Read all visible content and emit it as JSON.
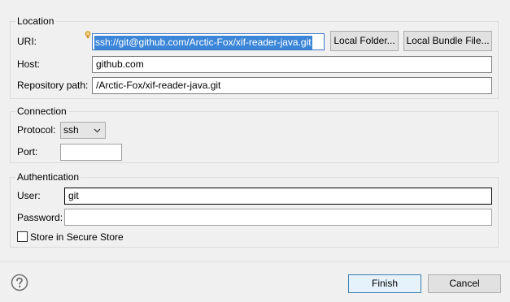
{
  "location": {
    "legend": "Location",
    "uri_label": "URI:",
    "uri_value": "ssh://git@github.com/Arctic-Fox/xif-reader-java.git",
    "local_folder_button": "Local Folder...",
    "local_bundle_button": "Local Bundle File...",
    "host_label": "Host:",
    "host_value": "github.com",
    "repo_path_label": "Repository path:",
    "repo_path_value": "/Arctic-Fox/xif-reader-java.git"
  },
  "connection": {
    "legend": "Connection",
    "protocol_label": "Protocol:",
    "protocol_value": "ssh",
    "port_label": "Port:",
    "port_value": ""
  },
  "authentication": {
    "legend": "Authentication",
    "user_label": "User:",
    "user_value": "git",
    "password_label": "Password:",
    "password_value": "",
    "secure_store_label": "Store in Secure Store",
    "secure_store_checked": false
  },
  "footer": {
    "finish_button": "Finish",
    "cancel_button": "Cancel"
  },
  "icons": {
    "help": "help-icon",
    "content_assist": "lightbulb-icon",
    "dropdown": "chevron-down-icon"
  },
  "colors": {
    "selection": "#3b86d8",
    "default_button_border": "#3c7fb1",
    "background": "#f0f0f0"
  }
}
